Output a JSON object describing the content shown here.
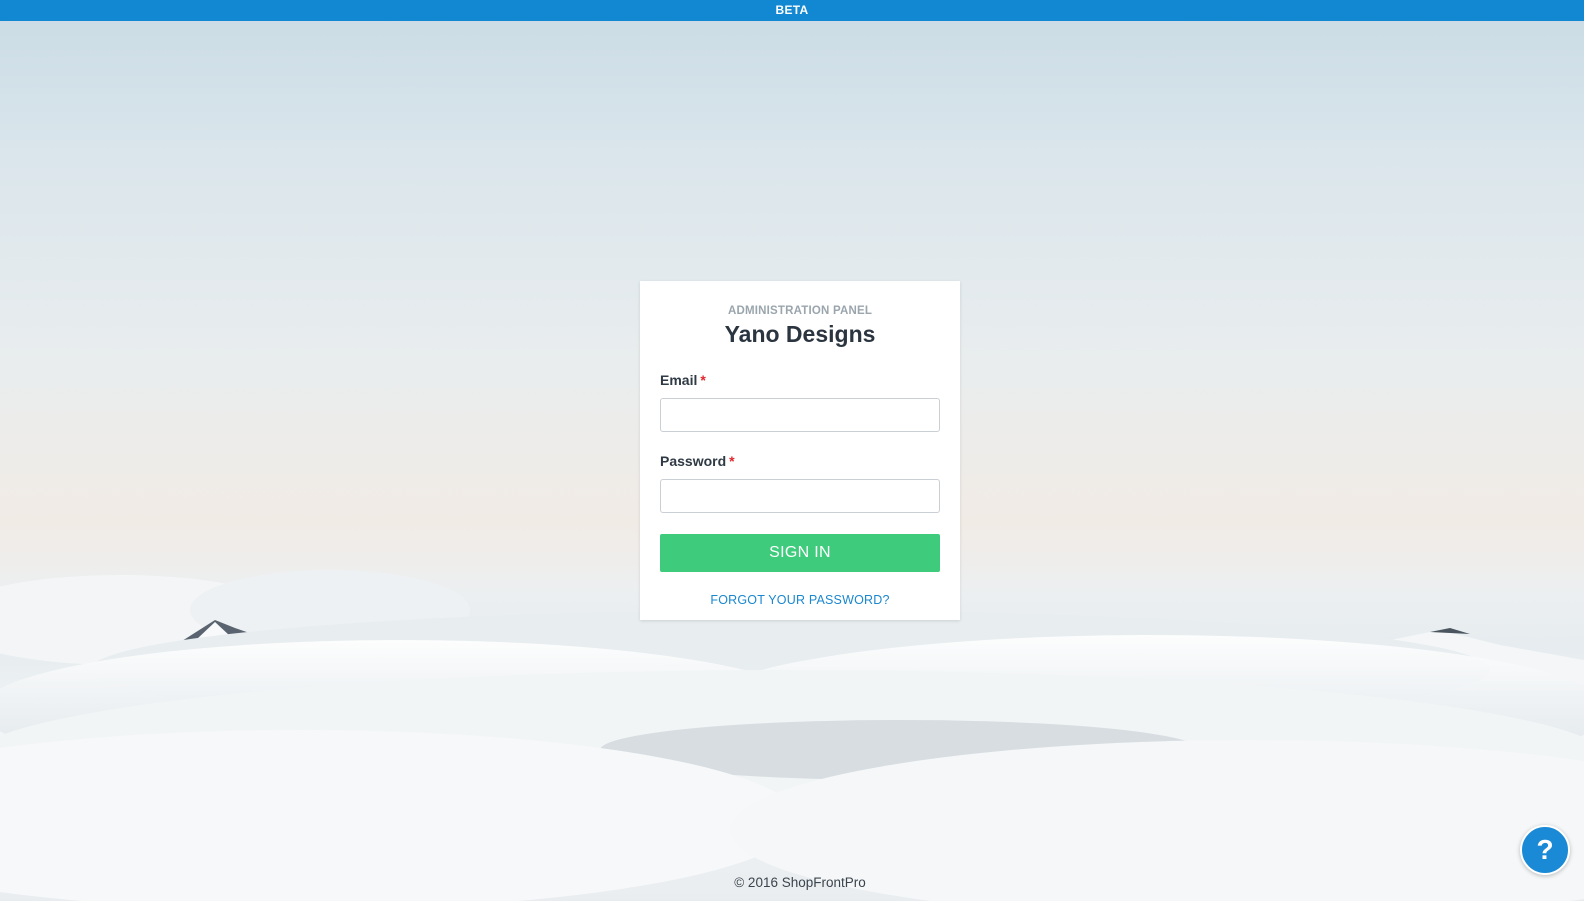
{
  "banner": {
    "label": "BETA"
  },
  "login": {
    "kicker": "ADMINISTRATION PANEL",
    "title": "Yano Designs",
    "email": {
      "label": "Email",
      "required_mark": "*",
      "value": "",
      "placeholder": ""
    },
    "password": {
      "label": "Password",
      "required_mark": "*",
      "value": "",
      "placeholder": ""
    },
    "submit_label": "SIGN IN",
    "forgot_label": "FORGOT YOUR PASSWORD?"
  },
  "footer": {
    "copyright": "© 2016 ShopFrontPro"
  },
  "help": {
    "icon": "question-icon",
    "glyph": "?"
  },
  "colors": {
    "beta_bar": "#1288d2",
    "primary_button": "#3ecb7c",
    "link": "#1a87cf",
    "required": "#e0262c",
    "help_button": "#1b8ad6"
  }
}
